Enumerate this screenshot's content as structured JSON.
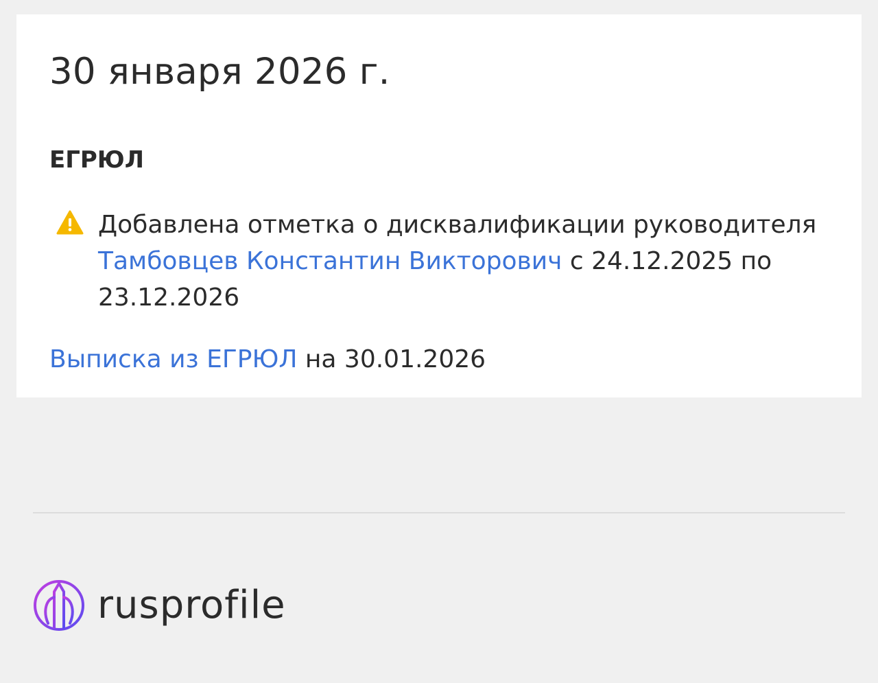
{
  "event_card": {
    "date": "30 января 2026 г.",
    "source": "ЕГРЮЛ",
    "event": {
      "icon": "warning-icon",
      "text_before": "Добавлена отметка о дисквалификации руководителя ",
      "person_link": "Тамбовцев Константин Викторович",
      "text_after": " с 24.12.2025 по 23.12.2026"
    },
    "extract": {
      "link_label": "Выписка из ЕГРЮЛ",
      "text_after": " на 30.01.2026"
    }
  },
  "footer": {
    "logo_icon": "rusprofile-logo-icon",
    "logo_text": "rusprofile"
  },
  "colors": {
    "link": "#3b73d8",
    "warning": "#f5b800",
    "text": "#2b2b2b",
    "background": "#f0f0f0",
    "card": "#ffffff",
    "logo_gradient_start": "#c13ee0",
    "logo_gradient_end": "#5a4cf0"
  }
}
